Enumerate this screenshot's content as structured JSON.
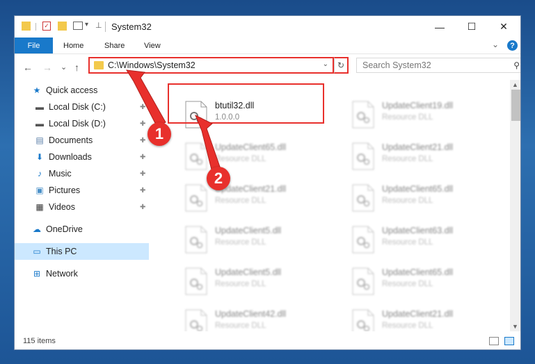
{
  "window": {
    "title": "System32",
    "controls": {
      "minimize": "—",
      "maximize": "☐",
      "close": "✕"
    }
  },
  "ribbon": {
    "file_tab": "File",
    "tabs": [
      "Home",
      "Share",
      "View"
    ],
    "help": "?",
    "collapse": "⌄"
  },
  "nav": {
    "back": "←",
    "forward": "→",
    "recent": "⌄",
    "up": "↑",
    "address": "C:\\Windows\\System32",
    "address_dropdown": "⌄",
    "refresh": "↻",
    "search_placeholder": "Search System32",
    "search_icon": "⚲"
  },
  "sidebar": {
    "items": [
      {
        "label": "Quick access",
        "icon": "star-icon",
        "glyph": "★",
        "color": "#1979ca",
        "pinned": false
      },
      {
        "label": "Local Disk (C:)",
        "icon": "drive-icon",
        "glyph": "▬",
        "color": "#555555",
        "pinned": true
      },
      {
        "label": "Local Disk (D:)",
        "icon": "drive-icon",
        "glyph": "▬",
        "color": "#555555",
        "pinned": true
      },
      {
        "label": "Documents",
        "icon": "documents-icon",
        "glyph": "▤",
        "color": "#5b7fa8",
        "pinned": true
      },
      {
        "label": "Downloads",
        "icon": "download-icon",
        "glyph": "⬇",
        "color": "#1979ca",
        "pinned": true
      },
      {
        "label": "Music",
        "icon": "music-icon",
        "glyph": "♪",
        "color": "#1979ca",
        "pinned": true
      },
      {
        "label": "Pictures",
        "icon": "pictures-icon",
        "glyph": "▣",
        "color": "#4a90c8",
        "pinned": true
      },
      {
        "label": "Videos",
        "icon": "videos-icon",
        "glyph": "▦",
        "color": "#333333",
        "pinned": true
      },
      {
        "label": "OneDrive",
        "icon": "cloud-icon",
        "glyph": "☁",
        "color": "#1979ca",
        "pinned": false
      },
      {
        "label": "This PC",
        "icon": "computer-icon",
        "glyph": "▭",
        "color": "#1979ca",
        "pinned": false,
        "selected": true
      },
      {
        "label": "Network",
        "icon": "network-icon",
        "glyph": "⊞",
        "color": "#1979ca",
        "pinned": false
      }
    ],
    "pin_glyph": "📌"
  },
  "files": {
    "focused": {
      "name": "btutil32.dll",
      "sub": "1.0.0.0"
    },
    "blurred": [
      {
        "name": "UpdateClient19.dll",
        "sub": "Resource DLL"
      },
      {
        "name": "UpdateClient65.dll",
        "sub": "Resource DLL"
      },
      {
        "name": "UpdateClient21.dll",
        "sub": "Resource DLL"
      },
      {
        "name": "UpdateClient21.dll",
        "sub": "Resource DLL"
      },
      {
        "name": "UpdateClient65.dll",
        "sub": "Resource DLL"
      },
      {
        "name": "UpdateClient5.dll",
        "sub": "Resource DLL"
      },
      {
        "name": "UpdateClient63.dll",
        "sub": "Resource DLL"
      },
      {
        "name": "UpdateClient5.dll",
        "sub": "Resource DLL"
      },
      {
        "name": "UpdateClient65.dll",
        "sub": "Resource DLL"
      },
      {
        "name": "UpdateClient42.dll",
        "sub": "Resource DLL"
      },
      {
        "name": "UpdateClient21.dll",
        "sub": "Resource DLL"
      }
    ]
  },
  "status": {
    "count": "115 items"
  },
  "callouts": [
    "1",
    "2"
  ],
  "colors": {
    "accent": "#1979ca",
    "annotation": "#e8302c",
    "selected": "#cce8ff"
  }
}
